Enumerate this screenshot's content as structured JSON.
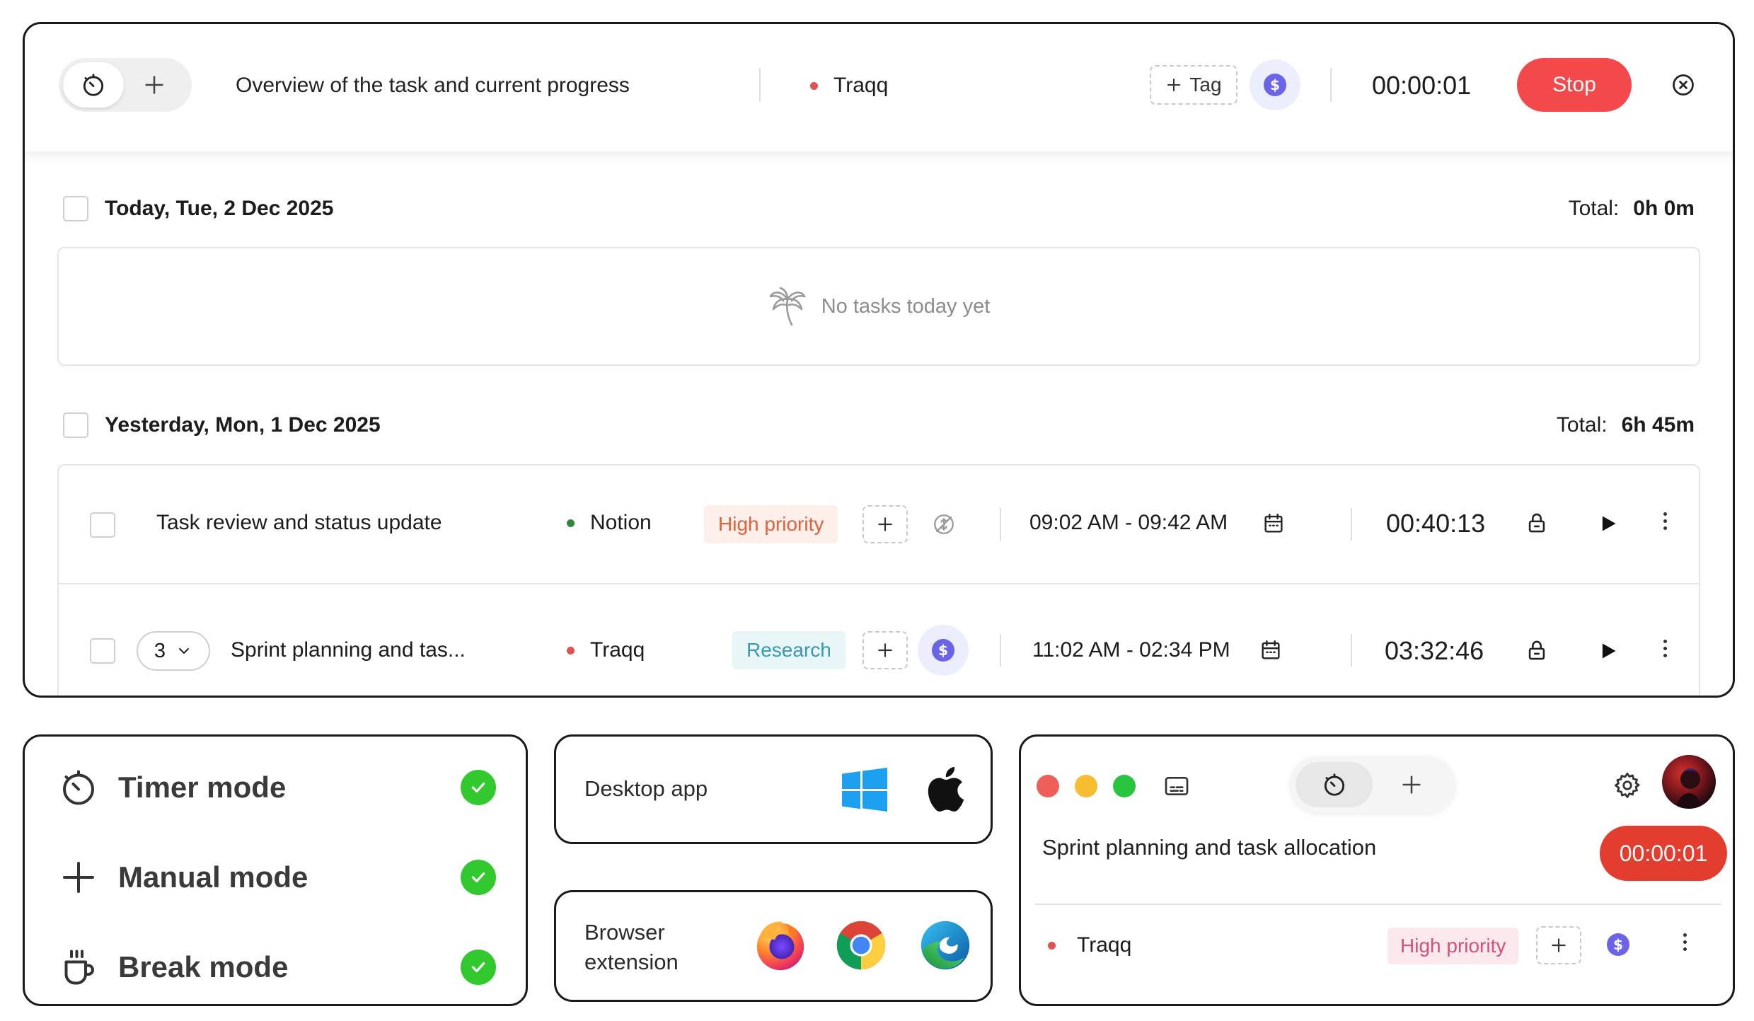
{
  "tracker": {
    "description": "Overview of the task and current progress",
    "project": "Traqq",
    "tag_button": "Tag",
    "elapsed": "00:00:01",
    "stop_label": "Stop"
  },
  "days": [
    {
      "heading": "Today, Tue, 2 Dec 2025",
      "total_label": "Total:",
      "total_value": "0h 0m",
      "empty_text": "No tasks today yet"
    },
    {
      "heading": "Yesterday, Mon, 1 Dec 2025",
      "total_label": "Total:",
      "total_value": "6h 45m"
    }
  ],
  "entries": [
    {
      "title": "Task review and status update",
      "project": "Notion",
      "tag": "High priority",
      "time_range": "09:02 AM - 09:42 AM",
      "duration": "00:40:13"
    },
    {
      "count": "3",
      "title": "Sprint planning and tas...",
      "project": "Traqq",
      "tag": "Research",
      "time_range": "11:02 AM - 02:34 PM",
      "duration": "03:32:46"
    }
  ],
  "modes": [
    {
      "label": "Timer mode"
    },
    {
      "label": "Manual mode"
    },
    {
      "label": "Break mode"
    }
  ],
  "platforms": {
    "desktop_label": "Desktop app",
    "browser_label_1": "Browser",
    "browser_label_2": "extension"
  },
  "mini_app": {
    "task": "Sprint planning and task allocation",
    "elapsed": "00:00:01",
    "project": "Traqq",
    "tag": "High priority"
  },
  "colors": {
    "stop": "#f4494b",
    "check": "#32c92f",
    "traqq_dot": "#e05252",
    "notion_dot": "#2e8b3a",
    "high_priority_bg": "#fdefe9",
    "high_priority_text": "#e2603a",
    "research_bg": "#e8f6f8",
    "research_text": "#3a98b0",
    "billable": "#6b63e8"
  },
  "icons": [
    "timer-icon",
    "plus-icon",
    "tag-plus-icon",
    "billable-icon",
    "close-circle-icon",
    "palm-tree-icon",
    "non-billable-icon",
    "calendar-icon",
    "lock-icon",
    "play-icon",
    "more-icon",
    "chevron-down-icon",
    "coffee-icon",
    "check-icon",
    "windows-icon",
    "apple-icon",
    "firefox-icon",
    "chrome-icon",
    "edge-icon",
    "caption-icon",
    "gear-icon",
    "avatar"
  ]
}
